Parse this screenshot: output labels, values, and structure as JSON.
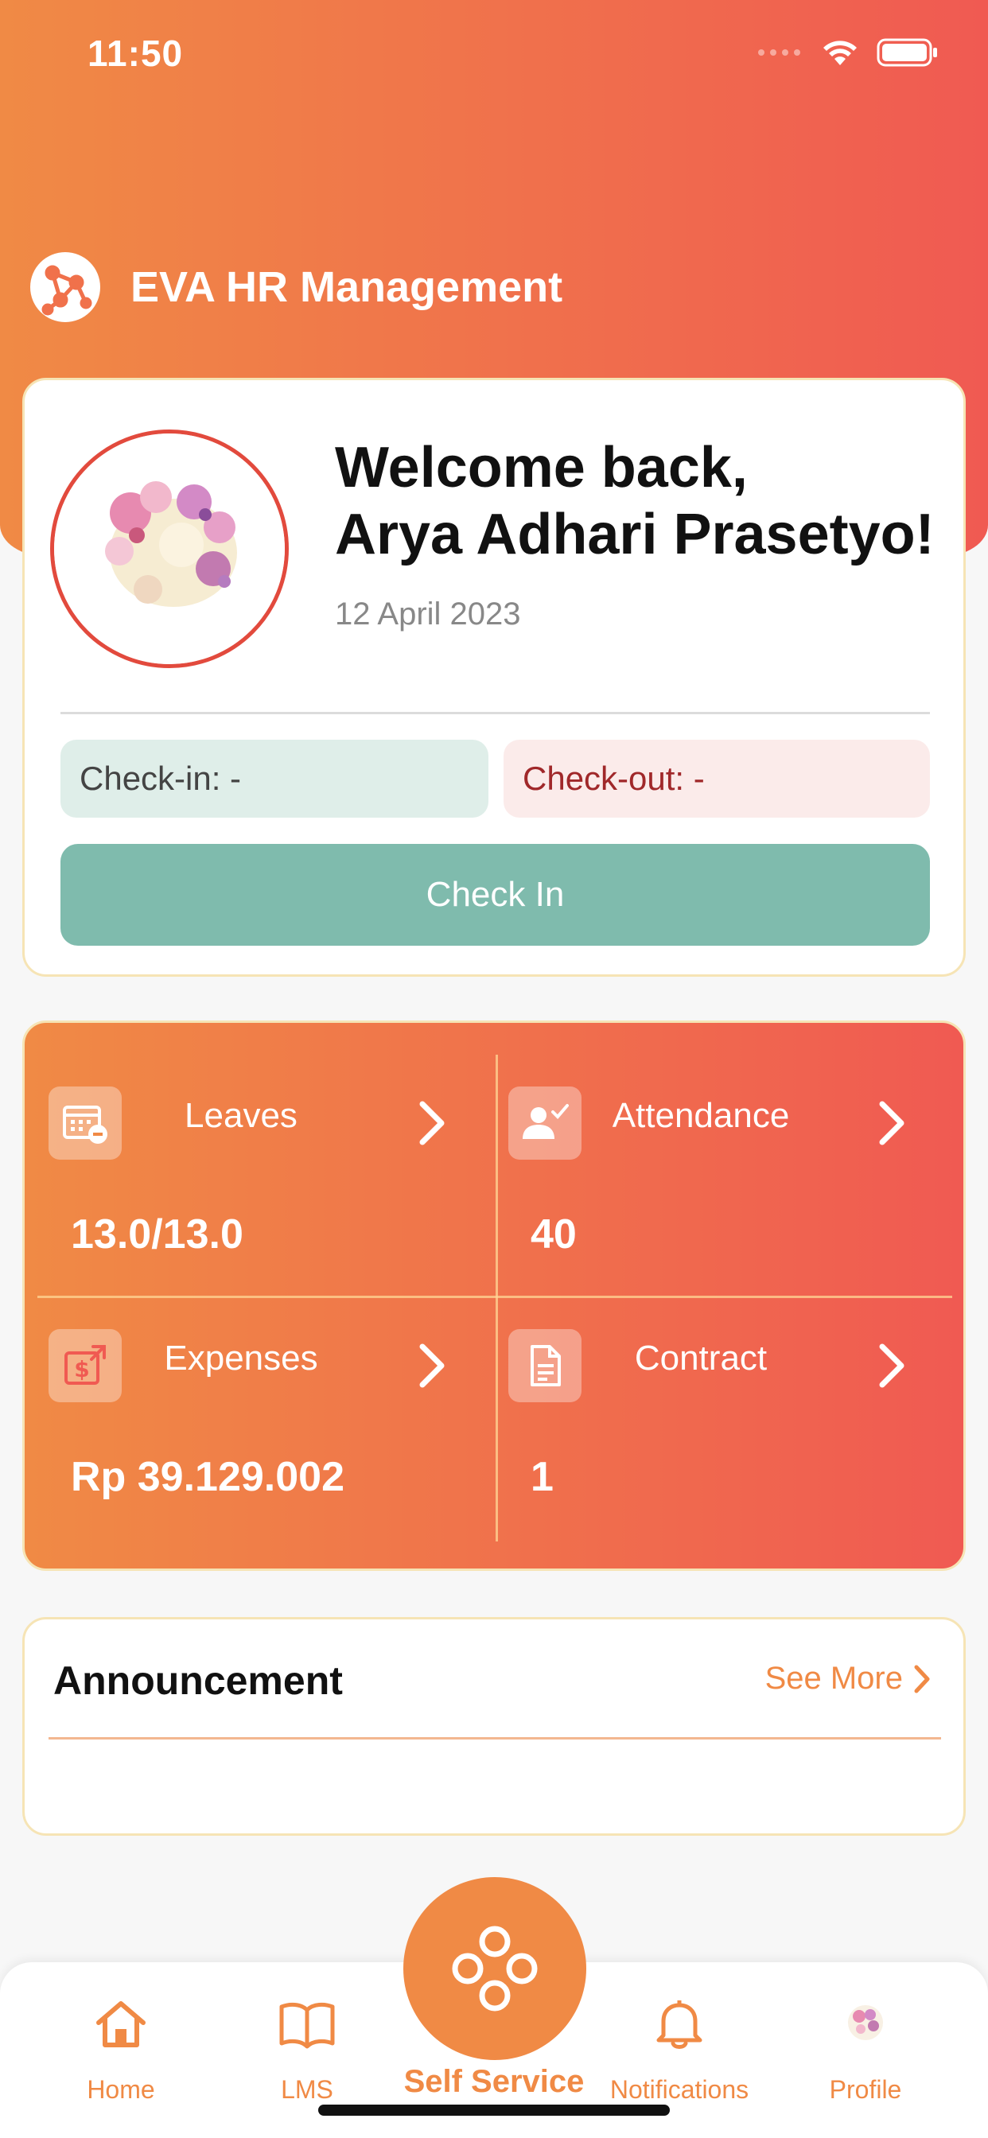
{
  "status_bar": {
    "time": "11:50"
  },
  "app_bar": {
    "title": "EVA HR Management"
  },
  "welcome": {
    "greeting_line1": "Welcome back,",
    "greeting_line2": "Arya Adhari Prasetyo!",
    "date": "12 April 2023",
    "checkin_label": "Check-in: -",
    "checkout_label": "Check-out: -",
    "checkin_button": "Check In"
  },
  "stats": [
    {
      "label": "Leaves",
      "value": "13.0/13.0",
      "icon": "calendar-minus-icon"
    },
    {
      "label": "Attendance",
      "value": "40",
      "icon": "user-check-icon"
    },
    {
      "label": "Expenses",
      "value": "Rp 39.129.002",
      "icon": "dollar-export-icon"
    },
    {
      "label": "Contract",
      "value": "1",
      "icon": "document-icon"
    }
  ],
  "announcement": {
    "title": "Announcement",
    "see_more": "See More"
  },
  "tabbar": {
    "home": "Home",
    "lms": "LMS",
    "self_service": "Self Service",
    "notifications": "Notifications",
    "profile": "Profile"
  },
  "colors": {
    "brand_orange": "#f08a45",
    "brand_red": "#f05a52",
    "checkin_teal": "#7fbbad"
  }
}
